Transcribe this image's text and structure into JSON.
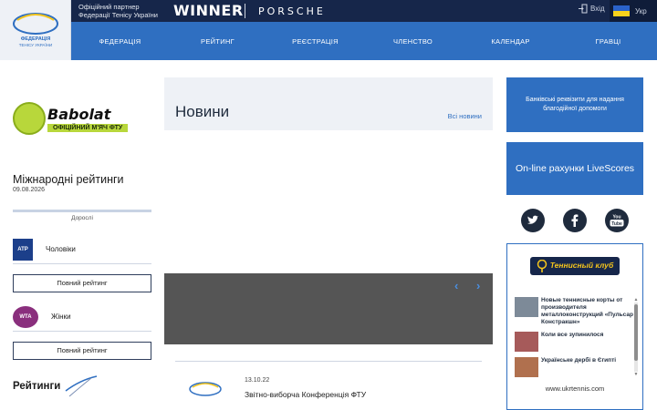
{
  "header": {
    "logo_text": "ФЕДЕРАЦІЯ ТЕНІСУ УКРАЇНИ",
    "partner_line1": "Офіційний партнер",
    "partner_line2": "Федерації Тенісу України",
    "sponsor1": "WINNER",
    "sponsor2": "PORSCHE",
    "login_label": "Вхід",
    "lang_label": "Укр",
    "flag_colors": [
      "#2a62c9",
      "#f7d21c"
    ]
  },
  "nav": {
    "items": [
      "ФЕДЕРАЦІЯ",
      "РЕЙТИНГ",
      "РЕЄСТРАЦІЯ",
      "ЧЛЕНСТВО",
      "КАЛЕНДАР",
      "ГРАВЦІ"
    ]
  },
  "left": {
    "babolat_brand": "Babolat",
    "babolat_tag": "ОФІЦІЙНИЙ М'ЯЧ ФТУ",
    "ratings_title": "Міжнародні рейтинги",
    "ratings_date": "09.08.2026",
    "ratings_tab": "Дорослі",
    "atp_badge": "ATP",
    "atp_label": "Чоловіки",
    "wta_badge": "WTA",
    "wta_label": "Жінки",
    "full_rating_button": "Повний рейтинг",
    "ratings2_title": "Рейтинги"
  },
  "center": {
    "news_title": "Новини",
    "all_news_link": "Всі новини",
    "news_item": {
      "date": "13.10.22",
      "title": "Звітно-виборча Конференція ФТУ",
      "thumb_text": "ФЕДЕРАЦІЯ ТЕНІСУ УКРАЇНИ"
    }
  },
  "right": {
    "bank_button": "Банківські реквізити для надання благодійної допомоги",
    "online_button": "On-line рахунки LiveScores",
    "social_icons": [
      "twitter-icon",
      "facebook-icon",
      "youtube-icon"
    ],
    "club_logo": "Теннисный клуб",
    "club_news": [
      "Новые теннисные корты от производителя металлоконструкций «Пульсар Констракшн»",
      "Коли все зупинилося",
      "Українське дербі в Єгипті"
    ],
    "club_url": "www.ukrtennis.com"
  },
  "colors": {
    "topbar": "#16264a",
    "nav": "#2f6fc1",
    "accent_green": "#b8d73b",
    "slider": "#555555"
  }
}
